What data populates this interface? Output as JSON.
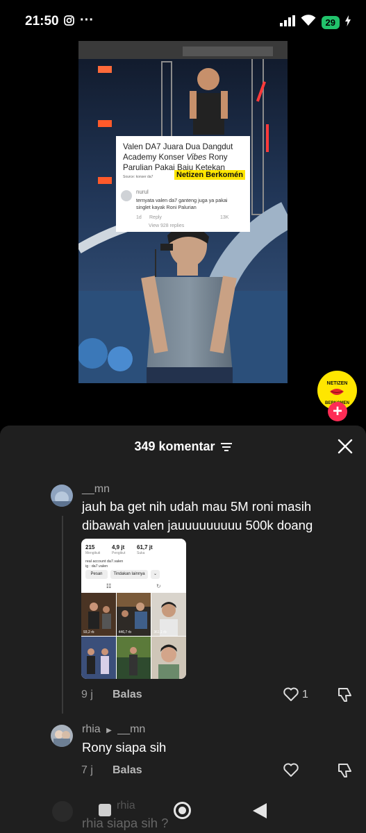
{
  "status_bar": {
    "time": "21:50",
    "dots": "···",
    "battery": "29",
    "battery_color": "#21c26b"
  },
  "video": {
    "headline_prefix": "Valen DA7 Juara Dua Dangdut Academy Konser ",
    "headline_italic": "Vibes",
    "headline_suffix": " Rony Parulian Pakai Baju Ketekan",
    "source": "Source: konser da7",
    "tag": "Netizen Berkomén",
    "embedded_comment": {
      "user": "nurul",
      "text": "ternyata valen da7 ganteng juga ya pakai singlet kayak Roni Palurian",
      "age": "1d",
      "reply": "Reply",
      "likes": "13K",
      "view_replies": "View 928 replies"
    }
  },
  "channel": {
    "logo_text": "NETIZEN BERKOMEN",
    "accent": "#ffe600",
    "plus_color": "#fe2c55"
  },
  "comments_sheet": {
    "title": "349 komentar",
    "comments": [
      {
        "user": "__mn",
        "text": "jauh ba get nih udah mau 5M roni masih dibawah valen jauuuuuuuuu 500k doang",
        "age": "9 j",
        "reply_label": "Balas",
        "likes": "1",
        "attachment": {
          "stats": [
            {
              "value": "215",
              "label": "Mengikuti"
            },
            {
              "value": "4,9 jt",
              "label": "Pengikut"
            },
            {
              "value": "61,7 jt",
              "label": "Suka"
            }
          ],
          "bio_line1": "real account da7.valen",
          "bio_line2": "ig : da7.valen",
          "button1": "Pesan",
          "button2": "Tindakan lainnya",
          "tile_counts": [
            "93,2 rb",
            "446,7 rb",
            "361,1 rb",
            "",
            "",
            ""
          ]
        }
      },
      {
        "user": "rhia",
        "reply_to": "__mn",
        "text": "Rony siapa sih",
        "age": "7 j",
        "reply_label": "Balas",
        "likes": ""
      },
      {
        "user": "rhia",
        "text": "rhia siapa sih ?"
      }
    ]
  }
}
